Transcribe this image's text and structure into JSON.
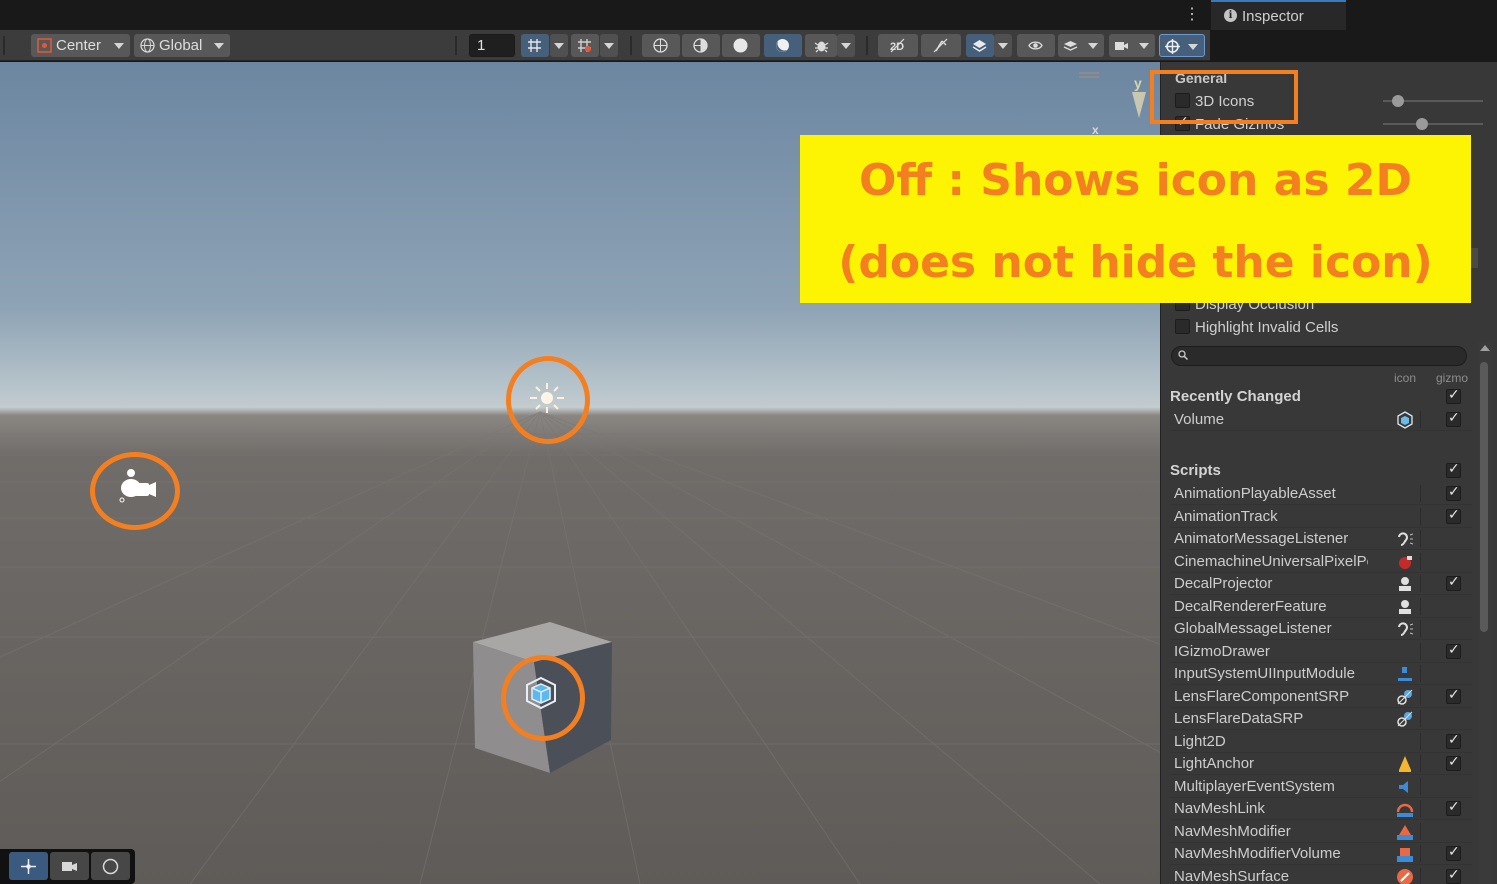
{
  "top": {
    "kebab_label": "⋮",
    "inspector_tab": {
      "label": "Inspector",
      "info_glyph": "i"
    }
  },
  "toolbar": {
    "pivot_mode": "Center",
    "pivot_rotation": "Global",
    "grid_increment": "1"
  },
  "scene": {
    "axis_y": "y",
    "axis_x": "x"
  },
  "gizmos_panel": {
    "general_header": "General",
    "three_d_icons": {
      "label": "3D Icons",
      "checked": false
    },
    "fade_gizmos": {
      "label": "Fade Gizmos",
      "checked": true
    },
    "display_occlusion": {
      "label": "Display Occlusion",
      "checked": false
    },
    "highlight_invalid_cells": {
      "label": "Highlight Invalid Cells",
      "checked": false
    },
    "column_icon": "icon",
    "column_gizmo": "gizmo",
    "recently_changed": {
      "header": "Recently Changed",
      "checked": true,
      "items": [
        {
          "name": "Volume",
          "icon": "volume-cube-icon",
          "gizmo": true
        }
      ]
    },
    "scripts": {
      "header": "Scripts",
      "checked": true,
      "items": [
        {
          "name": "AnimationPlayableAsset",
          "icon": "",
          "gizmo": true
        },
        {
          "name": "AnimationTrack",
          "icon": "",
          "gizmo": true
        },
        {
          "name": "AnimatorMessageListener",
          "icon": "ear-icon",
          "gizmo": null
        },
        {
          "name": "CinemachineUniversalPixelPerfect",
          "icon": "red-camera-icon",
          "gizmo": null
        },
        {
          "name": "DecalProjector",
          "icon": "decal-icon",
          "gizmo": true
        },
        {
          "name": "DecalRendererFeature",
          "icon": "decal-icon",
          "gizmo": null
        },
        {
          "name": "GlobalMessageListener",
          "icon": "ear-icon",
          "gizmo": null
        },
        {
          "name": "IGizmoDrawer",
          "icon": "",
          "gizmo": true
        },
        {
          "name": "InputSystemUIInputModule",
          "icon": "input-module-icon",
          "gizmo": null
        },
        {
          "name": "LensFlareComponentSRP",
          "icon": "lens-flare-icon",
          "gizmo": true
        },
        {
          "name": "LensFlareDataSRP",
          "icon": "lens-flare-icon",
          "gizmo": null
        },
        {
          "name": "Light2D",
          "icon": "",
          "gizmo": true
        },
        {
          "name": "LightAnchor",
          "icon": "light-anchor-icon",
          "gizmo": true
        },
        {
          "name": "MultiplayerEventSystem",
          "icon": "event-system-icon",
          "gizmo": null
        },
        {
          "name": "NavMeshLink",
          "icon": "navmesh-link-icon",
          "gizmo": true
        },
        {
          "name": "NavMeshModifier",
          "icon": "navmesh-modifier-icon",
          "gizmo": null
        },
        {
          "name": "NavMeshModifierVolume",
          "icon": "navmesh-volume-icon",
          "gizmo": true
        },
        {
          "name": "NavMeshSurface",
          "icon": "navmesh-surface-icon",
          "gizmo": true
        }
      ]
    }
  },
  "annotation": {
    "line1": "Off : Shows icon as 2D",
    "line2": "(does not hide the icon)",
    "color": "#f47f20",
    "background": "#fdf403"
  }
}
